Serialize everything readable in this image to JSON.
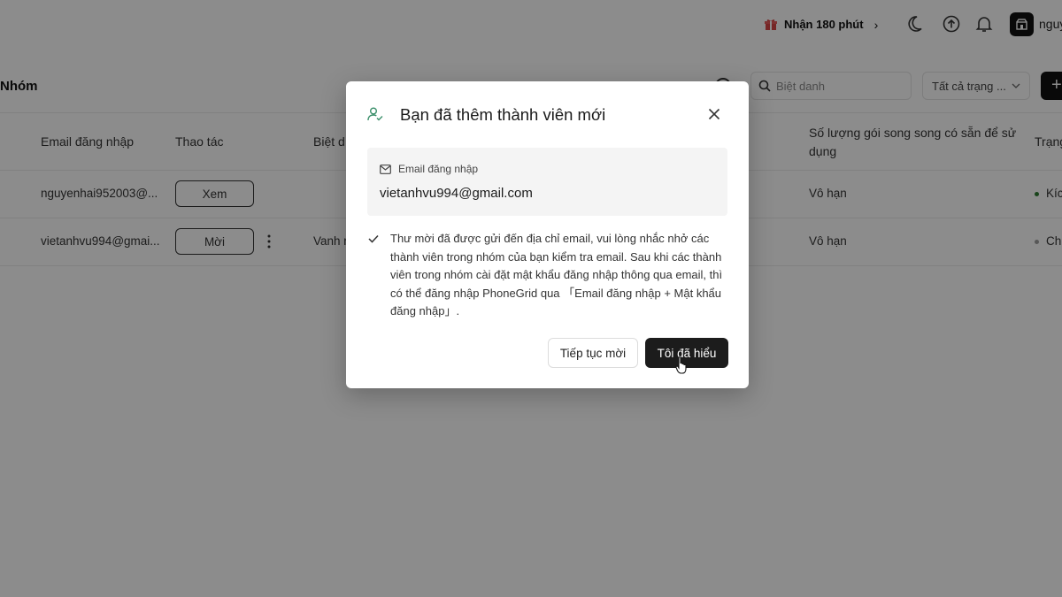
{
  "topbar": {
    "promo_label": "Nhận 180 phút",
    "promo_chevron": "›",
    "icons": [
      "moon-icon",
      "upload-icon",
      "bell-icon"
    ],
    "username": "nguy"
  },
  "toolbar": {
    "group_title": "Nhóm",
    "search_placeholder": "Biệt danh",
    "status_filter": "Tất cả trạng ...",
    "add_label": "+"
  },
  "table": {
    "headers": {
      "email": "Email đăng nhập",
      "action": "Thao tác",
      "nickname": "Biệt d",
      "parallel": "Số lượng gói song song có sẵn để sử dụng",
      "status": "Trạng"
    },
    "rows": [
      {
        "email": "nguyenhai952003@...",
        "action": "Xem",
        "nickname": "",
        "parallel": "Vô hạn",
        "status": "Kích",
        "status_color": "#2e7d32"
      },
      {
        "email": "vietanhvu994@gmai...",
        "action": "Mời",
        "nickname": "Vanh r",
        "parallel": "Vô hạn",
        "status": "Chu",
        "status_color": "#9e9e9e"
      }
    ]
  },
  "modal": {
    "title": "Bạn đã thêm thành viên mới",
    "email_label": "Email đăng nhập",
    "email_value": "vietanhvu994@gmail.com",
    "notice": "Thư mời đã được gửi đến địa chỉ email, vui lòng nhắc nhở các thành viên trong nhóm của bạn kiểm tra email. Sau khi các thành viên trong nhóm cài đặt mật khẩu đăng nhập thông qua email, thì có thể đăng nhập PhoneGrid qua 「Email đăng nhập + Mật khẩu đăng nhập」.",
    "continue_label": "Tiếp tục mời",
    "ok_label": "Tôi đã hiểu"
  },
  "colors": {
    "promo_gift": "#d84545",
    "primary_button": "#1c1c1c",
    "accent_icon": "#3a8f6a"
  }
}
